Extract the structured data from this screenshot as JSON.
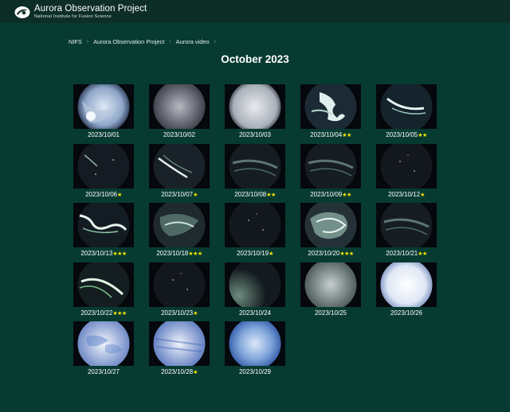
{
  "header": {
    "logo_title": "Aurora Observation Project",
    "logo_subtitle": "National Institute for Fusion Science"
  },
  "breadcrumb": [
    {
      "label": "NIFS"
    },
    {
      "label": "Aurora Observation Project"
    },
    {
      "label": "Aurora video"
    }
  ],
  "page_title": "October 2023",
  "colors": {
    "background": "#073b32",
    "topbar": "#0d2e26",
    "star": "#f7e600"
  },
  "gallery": [
    {
      "date": "2023/10/01",
      "stars": "",
      "sky": "bright-cloudy"
    },
    {
      "date": "2023/10/02",
      "stars": "",
      "sky": "overcast"
    },
    {
      "date": "2023/10/03",
      "stars": "",
      "sky": "overcast-bright"
    },
    {
      "date": "2023/10/04",
      "stars": "★★",
      "sky": "aurora-bright-curtain"
    },
    {
      "date": "2023/10/05",
      "stars": "★★",
      "sky": "aurora-arc"
    },
    {
      "date": "2023/10/06",
      "stars": "★",
      "sky": "dark-faint"
    },
    {
      "date": "2023/10/07",
      "stars": "★",
      "sky": "aurora-streak"
    },
    {
      "date": "2023/10/08",
      "stars": "★★",
      "sky": "aurora-faint-band"
    },
    {
      "date": "2023/10/09",
      "stars": "★★",
      "sky": "aurora-faint-band"
    },
    {
      "date": "2023/10/12",
      "stars": "★",
      "sky": "dark"
    },
    {
      "date": "2023/10/13",
      "stars": "★★★",
      "sky": "aurora-bright-curl"
    },
    {
      "date": "2023/10/18",
      "stars": "★★★",
      "sky": "aurora-diffuse"
    },
    {
      "date": "2023/10/19",
      "stars": "★",
      "sky": "dark"
    },
    {
      "date": "2023/10/20",
      "stars": "★★★",
      "sky": "aurora-bright-swirl"
    },
    {
      "date": "2023/10/21",
      "stars": "★★",
      "sky": "aurora-faint-band"
    },
    {
      "date": "2023/10/22",
      "stars": "★★★",
      "sky": "aurora-green-arc"
    },
    {
      "date": "2023/10/23",
      "stars": "★",
      "sky": "dark"
    },
    {
      "date": "2023/10/24",
      "stars": "",
      "sky": "dark-glow"
    },
    {
      "date": "2023/10/25",
      "stars": "",
      "sky": "twilight-gray"
    },
    {
      "date": "2023/10/26",
      "stars": "",
      "sky": "daylight"
    },
    {
      "date": "2023/10/27",
      "stars": "",
      "sky": "daylight-clouds"
    },
    {
      "date": "2023/10/28",
      "stars": "★",
      "sky": "daylight-streaks"
    },
    {
      "date": "2023/10/29",
      "stars": "",
      "sky": "blue-sky"
    }
  ]
}
